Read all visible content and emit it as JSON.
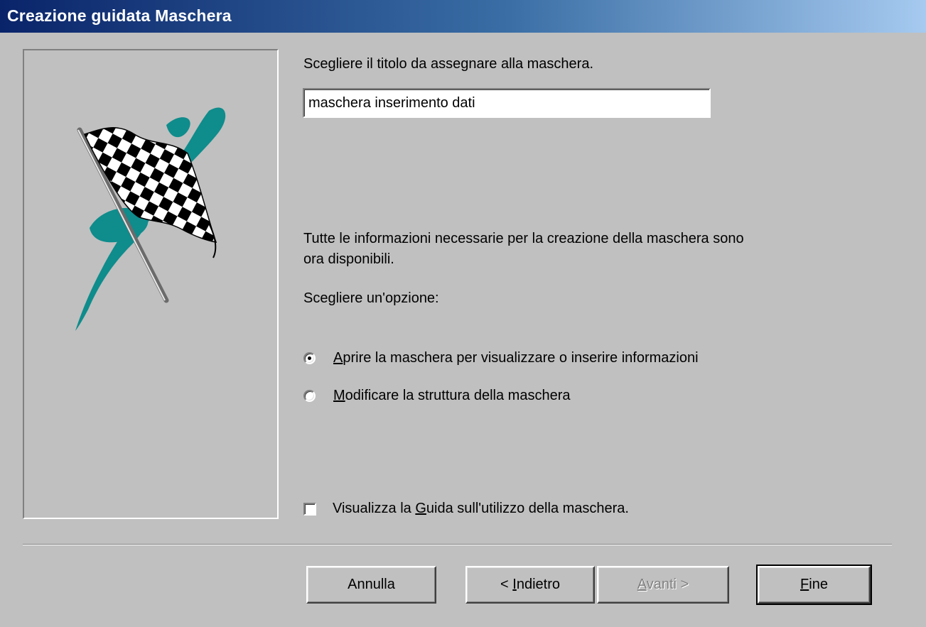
{
  "window": {
    "title": "Creazione guidata Maschera"
  },
  "form_title": {
    "prompt": "Scegliere il titolo da assegnare alla maschera.",
    "value": "maschera inserimento dati"
  },
  "info": {
    "text": "Tutte le informazioni necessarie per la creazione della maschera sono ora disponibili."
  },
  "options": {
    "prompt": "Scegliere un'opzione:",
    "selected": "open",
    "open": {
      "accel": "A",
      "rest": "prire la maschera per visualizzare o inserire informazioni",
      "checked": true
    },
    "modify": {
      "accel": "M",
      "rest": "odificare la struttura della maschera",
      "checked": false
    }
  },
  "help_checkbox": {
    "before": "Visualizza la ",
    "accel": "G",
    "after": "uida sull'utilizzo della maschera.",
    "checked": false
  },
  "buttons": {
    "cancel": "Annulla",
    "back_prefix": "< ",
    "back_accel": "I",
    "back_rest": "ndietro",
    "next_accel": "A",
    "next_rest": "vanti >",
    "next_enabled": false,
    "finish_accel": "F",
    "finish_rest": "ine"
  },
  "colors": {
    "title_active": "#0a246a",
    "dialog_face": "#c0c0c0",
    "flag_teal": "#0f8c8c"
  },
  "icons": {
    "wizard_picture": "checkered-flag-icon"
  }
}
